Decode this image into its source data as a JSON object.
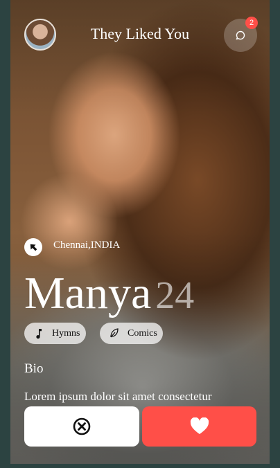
{
  "header": {
    "title": "They Liked You",
    "message_count": "2"
  },
  "profile": {
    "location": "Chennai,INDIA",
    "name": "Manya",
    "age": "24",
    "interests": [
      {
        "label": "Hymns",
        "icon": "music-note-icon"
      },
      {
        "label": "Comics",
        "icon": "leaf-icon"
      }
    ],
    "bio_heading": "Bio",
    "bio_text": "Lorem ipsum dolor sit amet consectetur"
  },
  "actions": {
    "dislike_icon": "close-circle-icon",
    "like_icon": "heart-icon"
  },
  "colors": {
    "accent": "#ff4f48",
    "background": "#2c4341"
  }
}
